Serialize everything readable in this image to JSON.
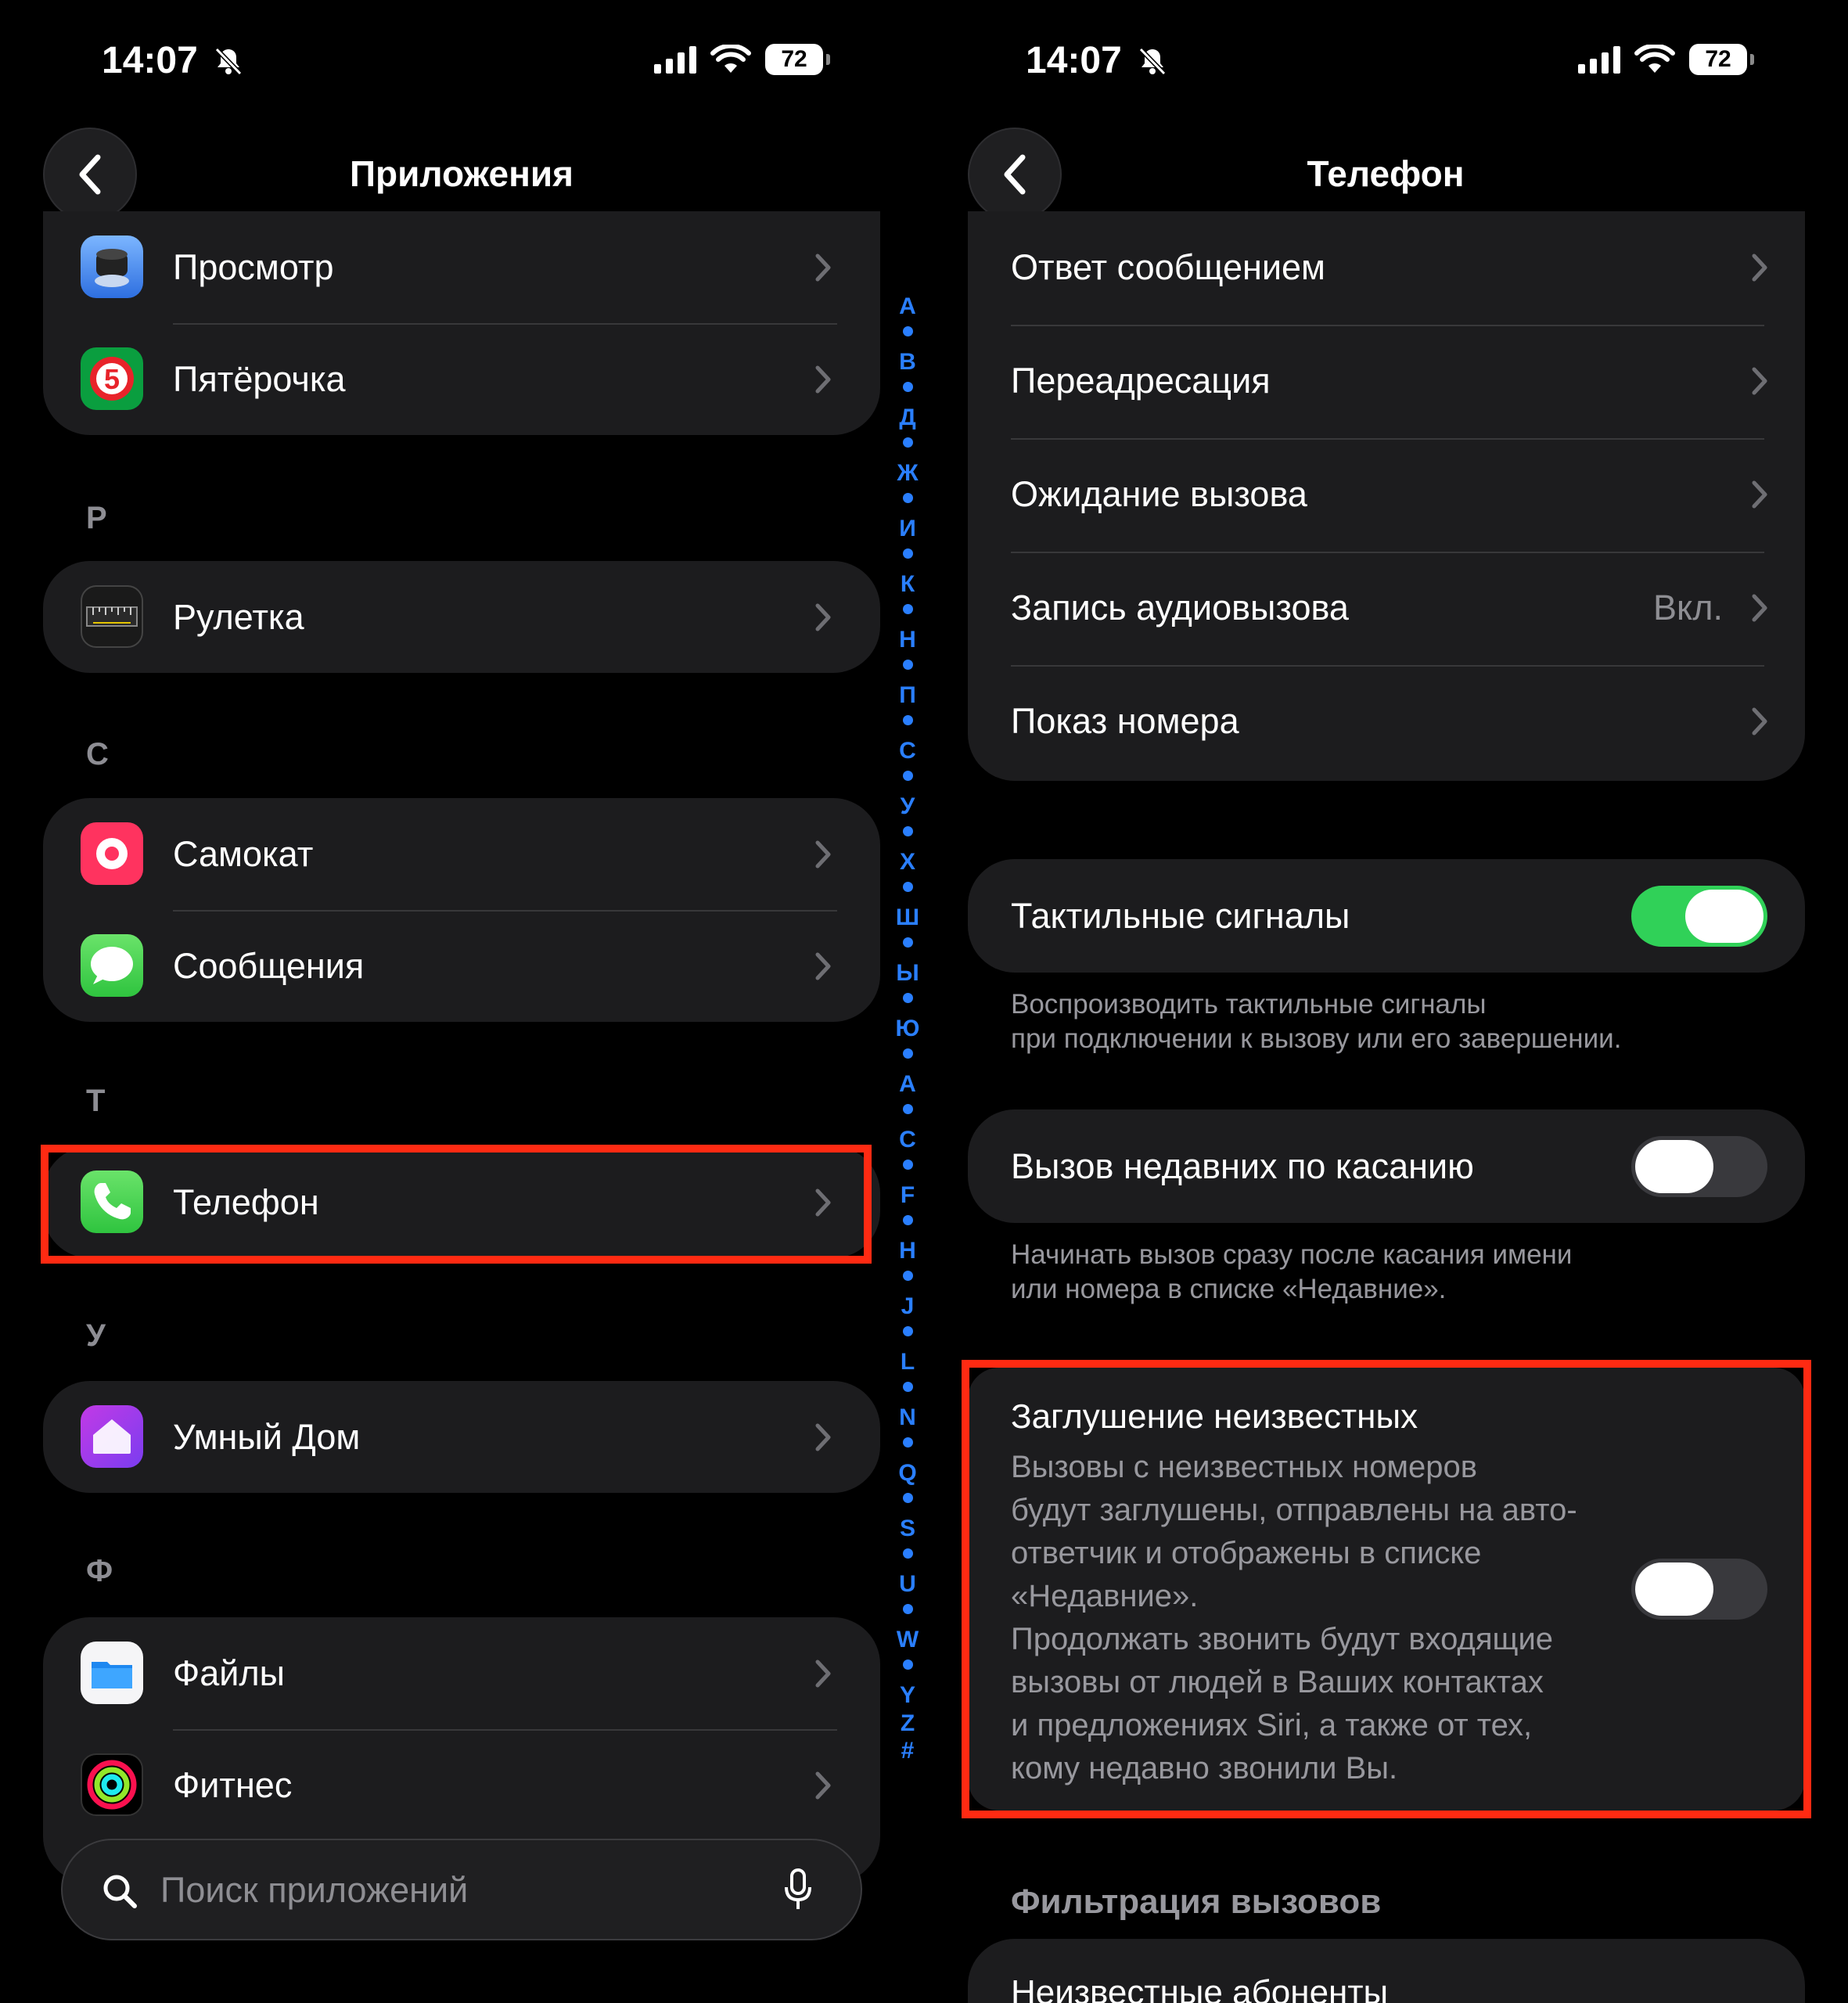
{
  "status_left": {
    "time": "14:07",
    "battery": "72"
  },
  "status_right": {
    "time": "14:07",
    "battery": "72"
  },
  "left": {
    "nav_title": "Приложения",
    "items_top": [
      {
        "label": "Просмотр"
      },
      {
        "label": "Пятёрочка"
      }
    ],
    "sections": [
      {
        "letter": "Р",
        "items": [
          {
            "label": "Рулетка"
          }
        ]
      },
      {
        "letter": "С",
        "items": [
          {
            "label": "Самокат"
          },
          {
            "label": "Сообщения"
          }
        ]
      },
      {
        "letter": "Т",
        "items": [
          {
            "label": "Телефон"
          }
        ]
      },
      {
        "letter": "У",
        "items": [
          {
            "label": "Умный Дом"
          }
        ]
      },
      {
        "letter": "Ф",
        "items": [
          {
            "label": "Файлы"
          },
          {
            "label": "Фитнес"
          }
        ]
      }
    ],
    "search_placeholder": "Поиск приложений",
    "index_letters": [
      "А",
      "В",
      "Д",
      "Ж",
      "И",
      "К",
      "Н",
      "П",
      "С",
      "У",
      "Х",
      "Ш",
      "Ы",
      "Ю",
      "A",
      "C",
      "F",
      "H",
      "J",
      "L",
      "N",
      "Q",
      "S",
      "U",
      "W",
      "Y",
      "Z",
      "#"
    ]
  },
  "right": {
    "nav_title": "Телефон",
    "rows": [
      {
        "label": "Ответ сообщением",
        "value": ""
      },
      {
        "label": "Переадресация",
        "value": ""
      },
      {
        "label": "Ожидание вызова",
        "value": ""
      },
      {
        "label": "Запись аудиовызова",
        "value": "Вкл."
      },
      {
        "label": "Показ номера",
        "value": ""
      }
    ],
    "haptics": {
      "label": "Тактильные сигналы",
      "on": true,
      "footnote_1": "Воспроизводить тактильные сигналы",
      "footnote_2": "при подключении к вызову или его завершении."
    },
    "tap_recent": {
      "label": "Вызов недавних по касанию",
      "on": false,
      "footnote_1": "Начинать вызов сразу после касания имени",
      "footnote_2": "или номера в списке «Недавние»."
    },
    "silence": {
      "title": "Заглушение неизвестных",
      "on": false,
      "lines": [
        "Вызовы с неизвестных номеров",
        "будут заглушены, отправлены на авто-",
        "ответчик и отображены в списке",
        "«Недавние».",
        "Продолжать звонить будут входящие",
        "вызовы от людей в Ваших контактах",
        "и предложениях Siri, а также от тех,",
        "кому недавно звонили Вы."
      ]
    },
    "filter_header": "Фильтрация вызовов",
    "filter_first_row": "Неизвестные абоненты"
  },
  "colors": {
    "accent_green": "#30d158",
    "highlight_red": "#ff2a12",
    "index_blue": "#2a7fff"
  }
}
